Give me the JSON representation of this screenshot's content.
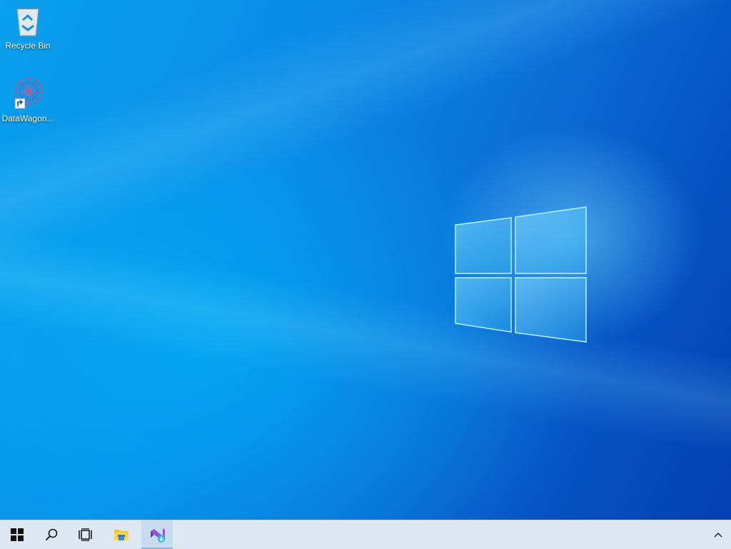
{
  "desktop": {
    "icons": [
      {
        "label": "Recycle Bin",
        "icon": "recycle-bin-icon"
      },
      {
        "label": "DataWagon...",
        "icon": "datawagon-shortcut-icon"
      }
    ]
  },
  "taskbar": {
    "buttons": [
      {
        "name": "start",
        "icon": "windows-logo-icon"
      },
      {
        "name": "search",
        "icon": "search-icon"
      },
      {
        "name": "task-view",
        "icon": "task-view-icon"
      },
      {
        "name": "file-explorer",
        "icon": "folder-icon"
      },
      {
        "name": "visual-studio-installer",
        "icon": "visual-studio-installer-icon",
        "active": true
      }
    ],
    "tray": {
      "chevron": "chevron-up-icon"
    }
  },
  "colors": {
    "taskbar_bg": "#dde8f2",
    "active_indicator": "#76b9ed",
    "wallpaper_primary": "#0a8be6"
  }
}
